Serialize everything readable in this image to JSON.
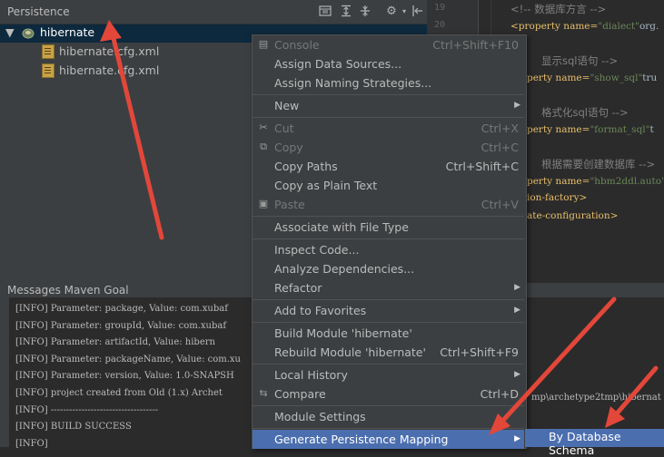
{
  "persistence": {
    "title": "Persistence",
    "tree": {
      "root": "hibernate",
      "children": [
        "hibernate.cfg.xml",
        "hibernate.cfg.xml"
      ]
    },
    "toolbar_icons": [
      "diagram-icon",
      "expand-icon",
      "collapse-icon",
      "gear-icon",
      "pin-icon"
    ]
  },
  "editor": {
    "line_numbers": [
      "19",
      "20"
    ],
    "lines": [
      {
        "type": "comment",
        "text": "<!-- 数据库方言 -->"
      },
      {
        "type": "prop",
        "name": "dialect",
        "tail": "org."
      },
      {
        "type": "comment",
        "text": "显示sql语句 -->"
      },
      {
        "type": "prop",
        "name": "show_sql",
        "tail": "tru"
      },
      {
        "type": "comment",
        "text": "格式化sql语句 -->"
      },
      {
        "type": "prop",
        "name": "format_sql",
        "tail": "t"
      },
      {
        "type": "comment",
        "text": "根据需要创建数据库 -->"
      },
      {
        "type": "prop",
        "name": "hbm2ddl.auto",
        "tail": ""
      },
      {
        "type": "tag",
        "text": "ion-factory>"
      },
      {
        "type": "tag",
        "text": "ate-configuration>"
      }
    ],
    "prop_prefix": "perty name=",
    "prop_prefix_full": "<property name="
  },
  "messages": {
    "title": "Messages Maven Goal",
    "lines": [
      "[INFO] Parameter: package, Value: com.xubaf",
      "[INFO] Parameter: groupId, Value: com.xubaf",
      "[INFO] Parameter: artifactId, Value: hibern",
      "[INFO] Parameter: packageName, Value: com.xu",
      "[INFO] Parameter: version, Value: 1.0-SNAPSH",
      "[INFO] project created from Old (1.x) Archet",
      "[INFO] -----------------------------------",
      "[INFO] BUILD SUCCESS",
      "[INFO]"
    ],
    "tail_text": "mp\\archetype2tmp\\hibernat"
  },
  "context_menu": {
    "items": [
      {
        "label": "Console",
        "shortcut": "Ctrl+Shift+F10",
        "disabled": true,
        "icon": "console-icon"
      },
      {
        "label": "Assign Data Sources...",
        "shortcut": ""
      },
      {
        "label": "Assign Naming Strategies...",
        "shortcut": ""
      },
      {
        "sep": true
      },
      {
        "label": "New",
        "submenu": true
      },
      {
        "sep": true
      },
      {
        "label": "Cut",
        "shortcut": "Ctrl+X",
        "disabled": true,
        "icon": "cut-icon"
      },
      {
        "label": "Copy",
        "shortcut": "Ctrl+C",
        "disabled": true,
        "icon": "copy-icon"
      },
      {
        "label": "Copy Paths",
        "shortcut": "Ctrl+Shift+C"
      },
      {
        "label": "Copy as Plain Text",
        "shortcut": ""
      },
      {
        "label": "Paste",
        "shortcut": "Ctrl+V",
        "disabled": true,
        "icon": "paste-icon"
      },
      {
        "sep": true
      },
      {
        "label": "Associate with File Type",
        "shortcut": ""
      },
      {
        "sep": true
      },
      {
        "label": "Inspect Code...",
        "shortcut": ""
      },
      {
        "label": "Analyze Dependencies...",
        "shortcut": ""
      },
      {
        "label": "Refactor",
        "submenu": true
      },
      {
        "sep": true
      },
      {
        "label": "Add to Favorites",
        "submenu": true
      },
      {
        "sep": true
      },
      {
        "label": "Build Module 'hibernate'",
        "shortcut": ""
      },
      {
        "label": "Rebuild Module 'hibernate'",
        "shortcut": "Ctrl+Shift+F9"
      },
      {
        "sep": true
      },
      {
        "label": "Local History",
        "submenu": true
      },
      {
        "label": "Compare",
        "shortcut": "Ctrl+D",
        "icon": "compare-icon"
      },
      {
        "sep": true
      },
      {
        "label": "Module Settings",
        "shortcut": ""
      },
      {
        "sep": true
      },
      {
        "label": "Generate Persistence Mapping",
        "submenu": true,
        "selected": true
      }
    ]
  },
  "submenu": {
    "item": "By Database Schema"
  },
  "colors": {
    "selection": "#4b6eaf",
    "annotation_arrow": "#e2473a"
  }
}
